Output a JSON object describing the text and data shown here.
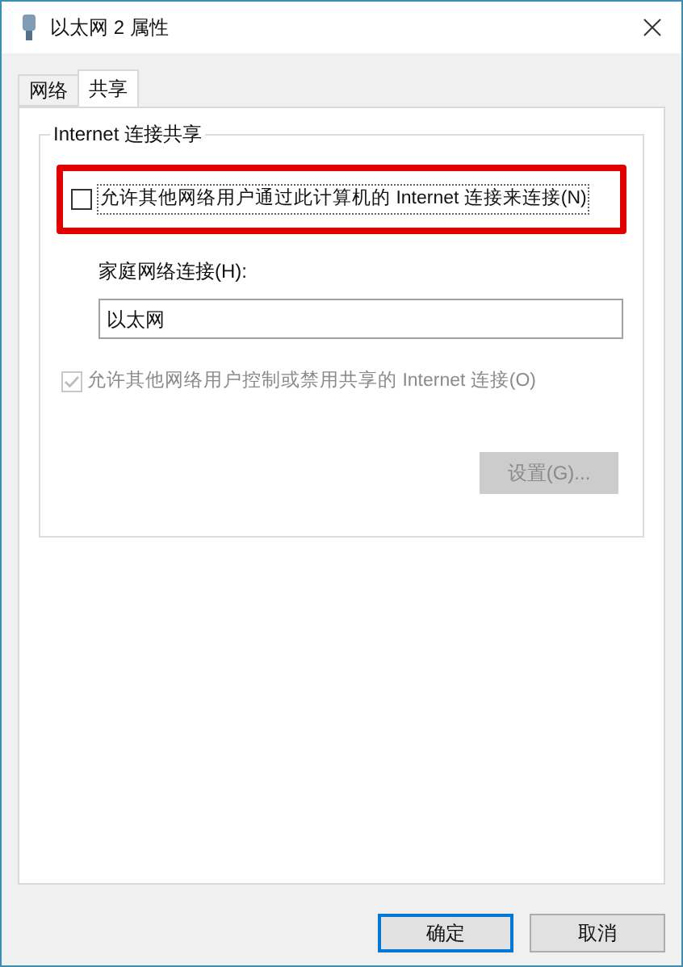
{
  "window": {
    "title": "以太网 2 属性"
  },
  "tabs": [
    {
      "label": "网络",
      "selected": false
    },
    {
      "label": "共享",
      "selected": true
    }
  ],
  "group": {
    "title": "Internet 连接共享",
    "allow_sharing": {
      "label": "允许其他网络用户通过此计算机的 Internet 连接来连接(N)",
      "checked": false,
      "highlighted": true
    },
    "home_network": {
      "label": "家庭网络连接(H):",
      "value": "以太网"
    },
    "allow_control": {
      "label": "允许其他网络用户控制或禁用共享的 Internet 连接(O)",
      "checked": true,
      "disabled": true
    },
    "settings_button": {
      "label": "设置(G)...",
      "disabled": true
    }
  },
  "buttons": [
    {
      "label": "确定",
      "default": true
    },
    {
      "label": "取消",
      "default": false
    }
  ]
}
